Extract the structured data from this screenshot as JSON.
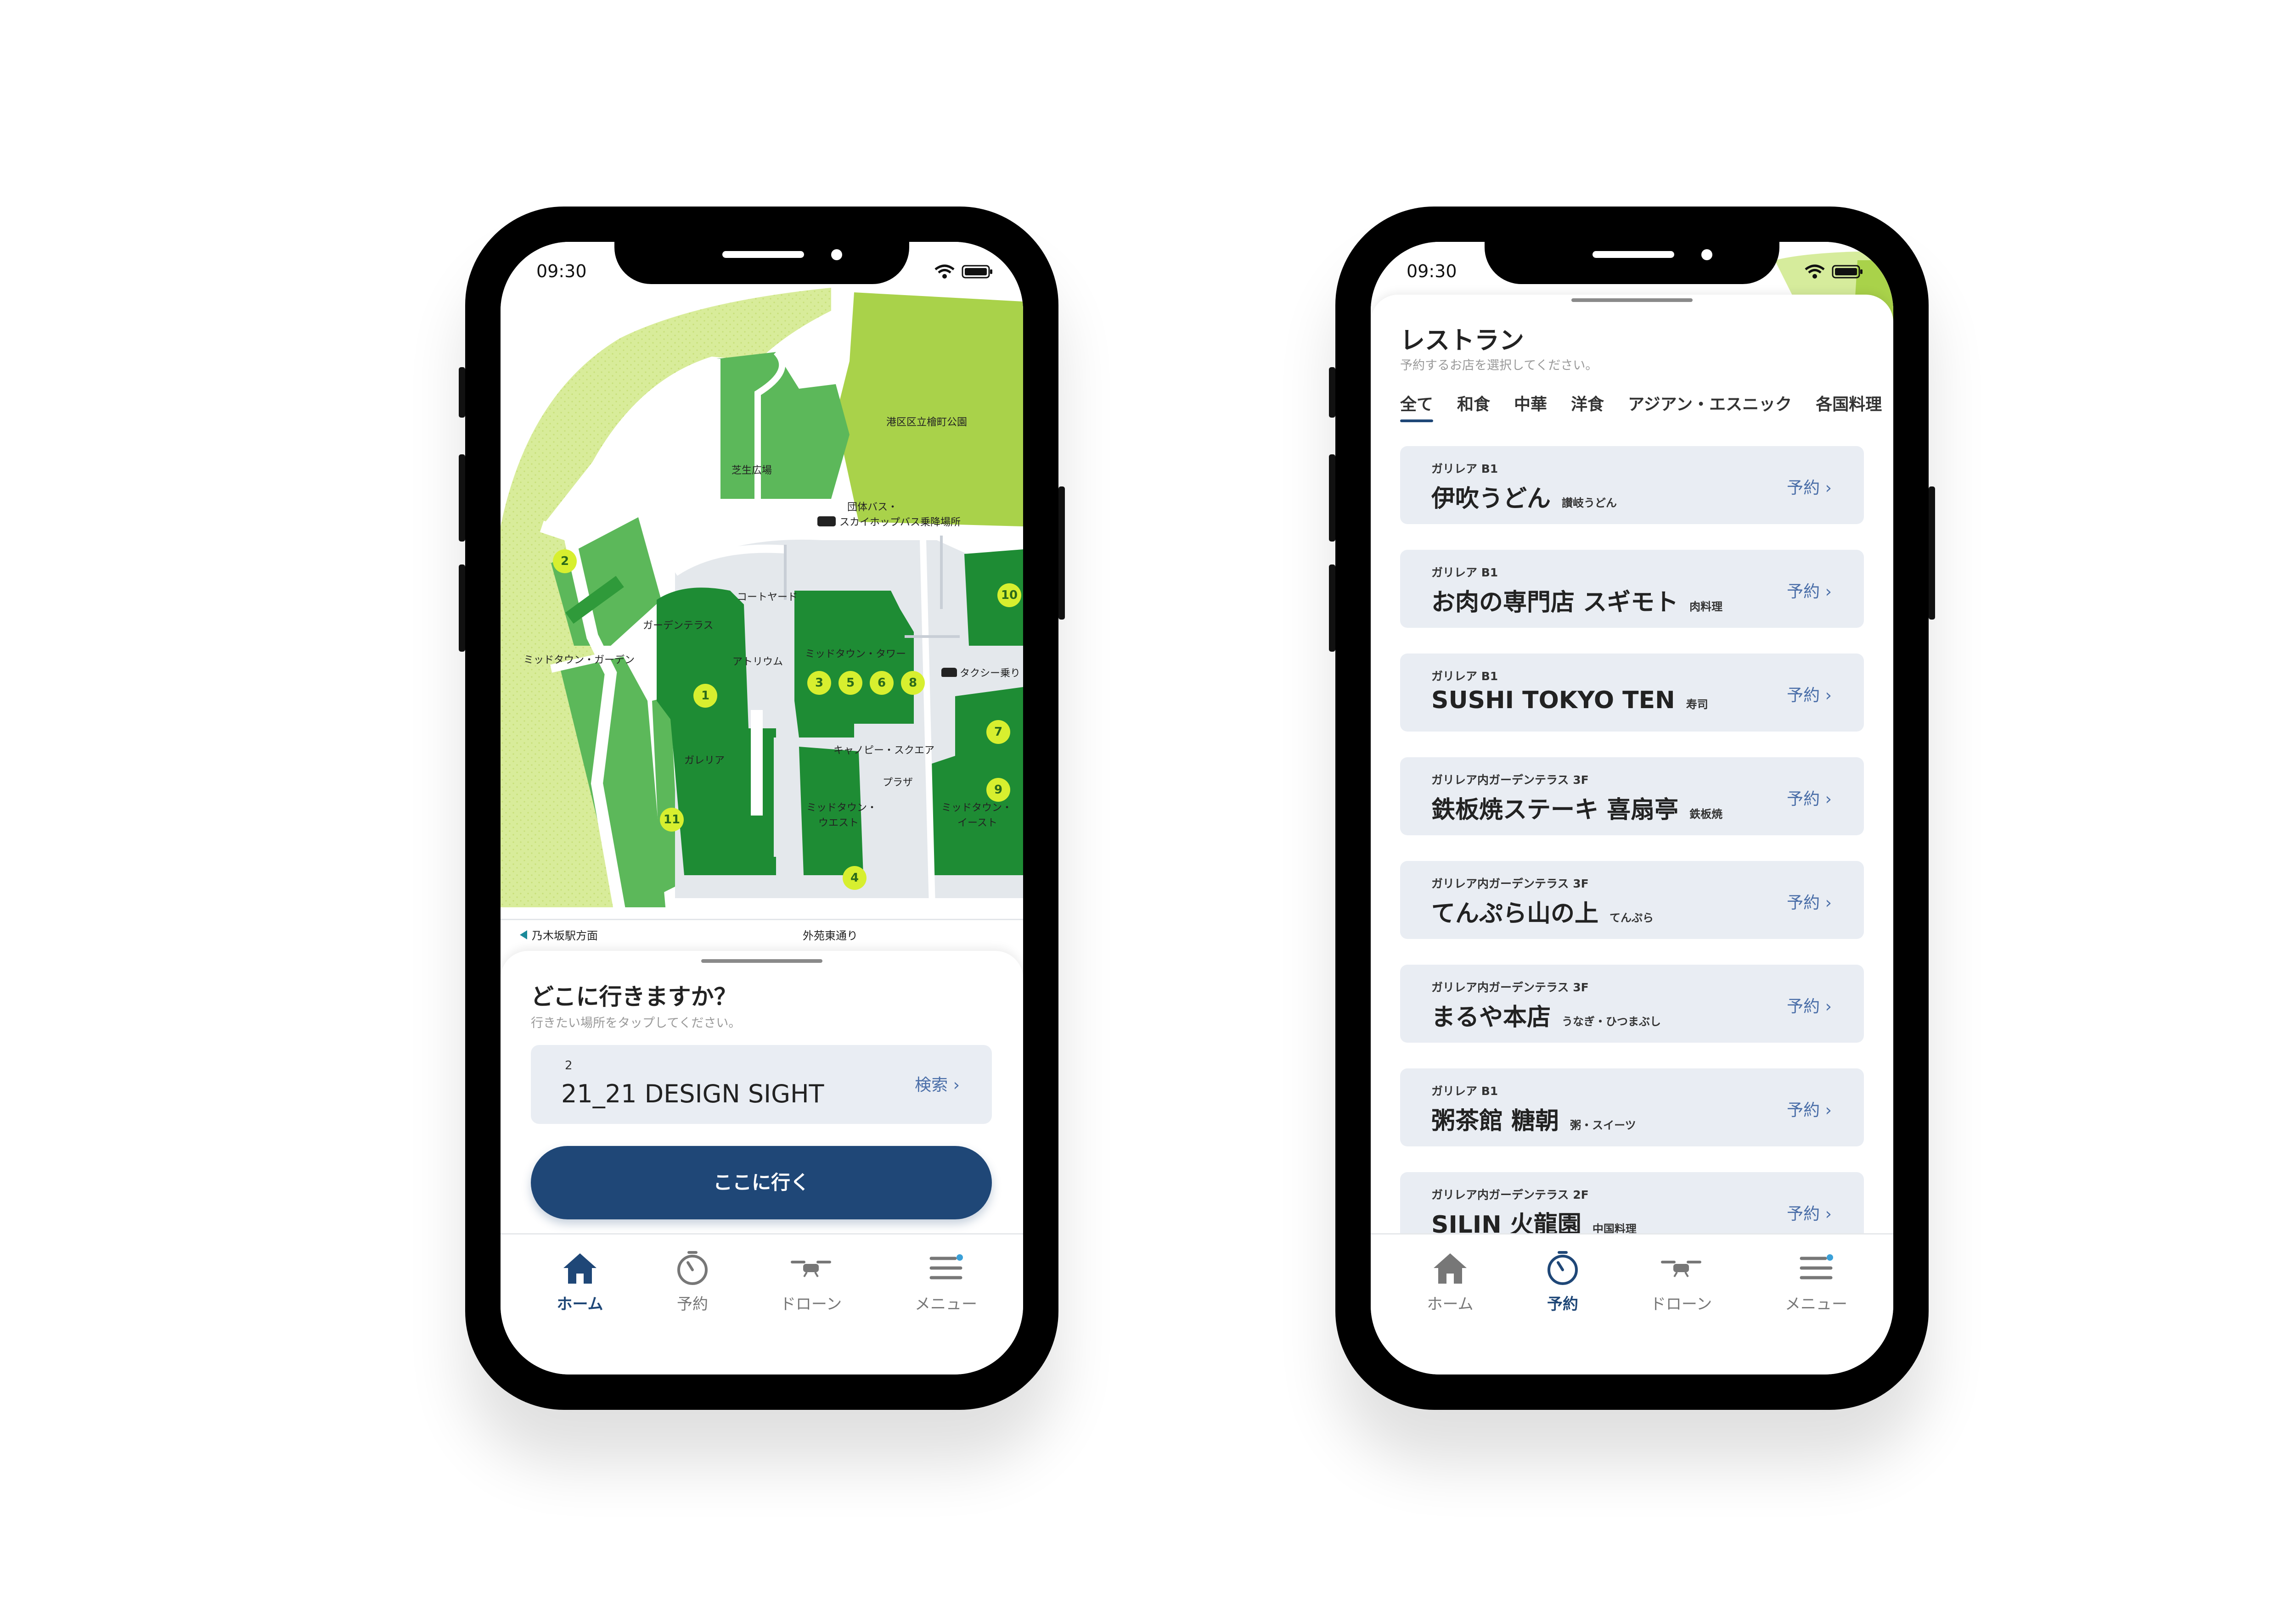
{
  "status": {
    "time": "09:30"
  },
  "left_screen": {
    "map": {
      "labels": {
        "park": "港区区立檜町公園",
        "lawn": "芝生広場",
        "bus1": "団体バス・",
        "bus2": "スカイホップバス乗降場所",
        "courtyard": "コートヤード",
        "garden_terrace": "ガーデンテラス",
        "midtown_garden": "ミッドタウン・ガーデン",
        "atrium": "アトリウム",
        "midtown_tower": "ミッドタウン・タワー",
        "taxi": "タクシー乗り",
        "galleria": "ガレリア",
        "canopy": "キャノピー・スクエア",
        "plaza": "プラザ",
        "west1": "ミッドタウン・",
        "west2": "ウエスト",
        "east1": "ミッドタウン・",
        "east2": "イースト",
        "nogizaka": "乃木坂駅方面",
        "gaien": "外苑東通り"
      },
      "pins": [
        "1",
        "2",
        "3",
        "4",
        "5",
        "6",
        "7",
        "8",
        "9",
        "10",
        "11"
      ]
    },
    "sheet": {
      "title": "どこに行きますか？",
      "subtitle": "行きたい場所をタップしてください。",
      "dest_number": "2",
      "dest_name": "21_21 DESIGN SIGHT",
      "search_label": "検索 ›",
      "go_button": "ここに行く"
    },
    "tabs": [
      "ホーム",
      "予約",
      "ドローン",
      "メニュー"
    ],
    "active_tab": "ホーム"
  },
  "right_screen": {
    "title": "レストラン",
    "subtitle": "予約するお店を選択してください。",
    "categories": [
      "全て",
      "和食",
      "中華",
      "洋食",
      "アジアン・エスニック",
      "各国料理"
    ],
    "active_category": "全て",
    "reserve_label": "予約 ›",
    "restaurants": [
      {
        "location": "ガリレア B1",
        "name": "伊吹うどん",
        "genre": "讃岐うどん"
      },
      {
        "location": "ガリレア B1",
        "name": "お肉の専門店 スギモト",
        "genre": "肉料理"
      },
      {
        "location": "ガリレア B1",
        "name": "SUSHI TOKYO TEN",
        "genre": "寿司"
      },
      {
        "location": "ガリレア内ガーデンテラス 3F",
        "name": "鉄板焼ステーキ 喜扇亭",
        "genre": "鉄板焼"
      },
      {
        "location": "ガリレア内ガーデンテラス 3F",
        "name": "てんぷら山の上",
        "genre": "てんぷら"
      },
      {
        "location": "ガリレア内ガーデンテラス 3F",
        "name": "まるや本店",
        "genre": "うなぎ・ひつまぶし"
      },
      {
        "location": "ガリレア B1",
        "name": "粥茶館 糖朝",
        "genre": "粥・スイーツ"
      },
      {
        "location": "ガリレア内ガーデンテラス 2F",
        "name": "SILIN 火龍園",
        "genre": "中国料理"
      }
    ],
    "tabs": [
      "ホーム",
      "予約",
      "ドローン",
      "メニュー"
    ],
    "active_tab": "予約"
  },
  "colors": {
    "accent": "#1f4777",
    "link": "#4a6ea8",
    "building": "#1e8c34",
    "park_dark": "#5cb85a",
    "park_light": "#d6ec9c",
    "pin": "#d7ef2f"
  }
}
